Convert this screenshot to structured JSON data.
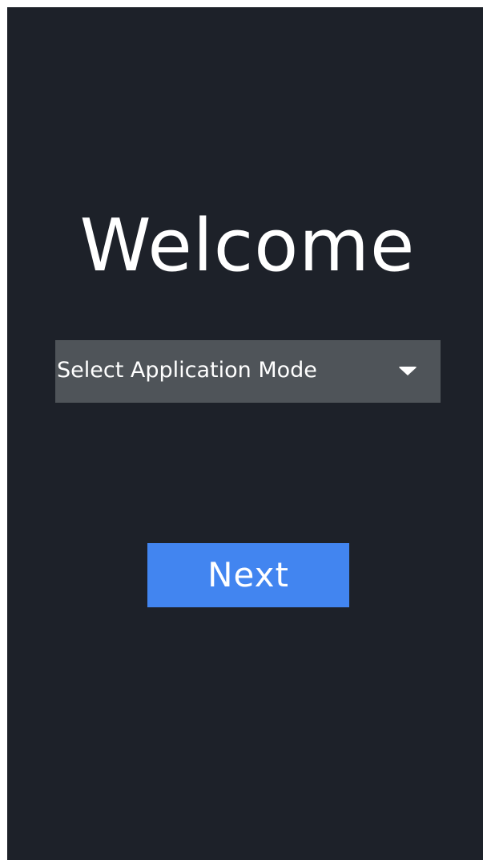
{
  "welcome": {
    "title": "Welcome"
  },
  "mode_select": {
    "selected_label": "Select Application Mode",
    "icon": "caret-down-icon"
  },
  "actions": {
    "next_label": "Next"
  },
  "colors": {
    "background": "#1d2129",
    "select_background": "#4f5459",
    "button_background": "#4285f0",
    "text": "#ffffff"
  }
}
